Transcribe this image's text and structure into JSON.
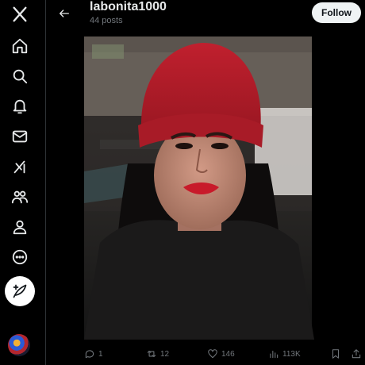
{
  "profile": {
    "username": "labonita1000",
    "post_count_label": "44 posts",
    "follow_label": "Follow"
  },
  "post": {
    "reply_count": "1",
    "repost_count": "12",
    "like_count": "146",
    "view_count": "113K"
  },
  "colors": {
    "background": "#000000",
    "follow_button": "#eff3f4",
    "muted_text": "#71767b",
    "beanie_red": "#c0202e"
  },
  "nav": {
    "icons": [
      "x-logo-icon",
      "home-icon",
      "search-icon",
      "notifications-icon",
      "messages-icon",
      "grok-icon",
      "communities-icon",
      "profile-icon",
      "more-icon",
      "compose-post-icon"
    ]
  }
}
